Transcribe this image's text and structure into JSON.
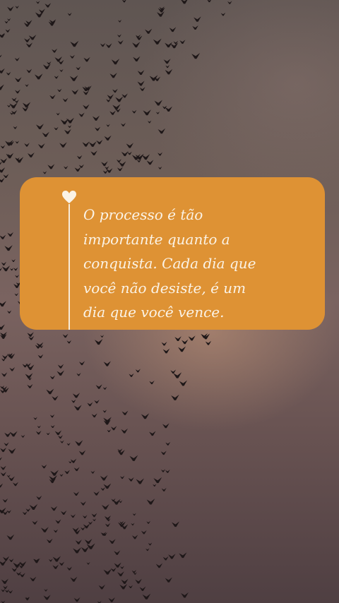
{
  "colors": {
    "card": "#de9234",
    "text": "#fbf3e6",
    "birds": "#1e1718"
  },
  "quote": {
    "lines": [
      "O processo é tão",
      "importante quanto a",
      "conquista. Cada dia que",
      "você não desiste, é um",
      "dia que você vence."
    ]
  },
  "icons": {
    "heart": "heart-icon"
  }
}
